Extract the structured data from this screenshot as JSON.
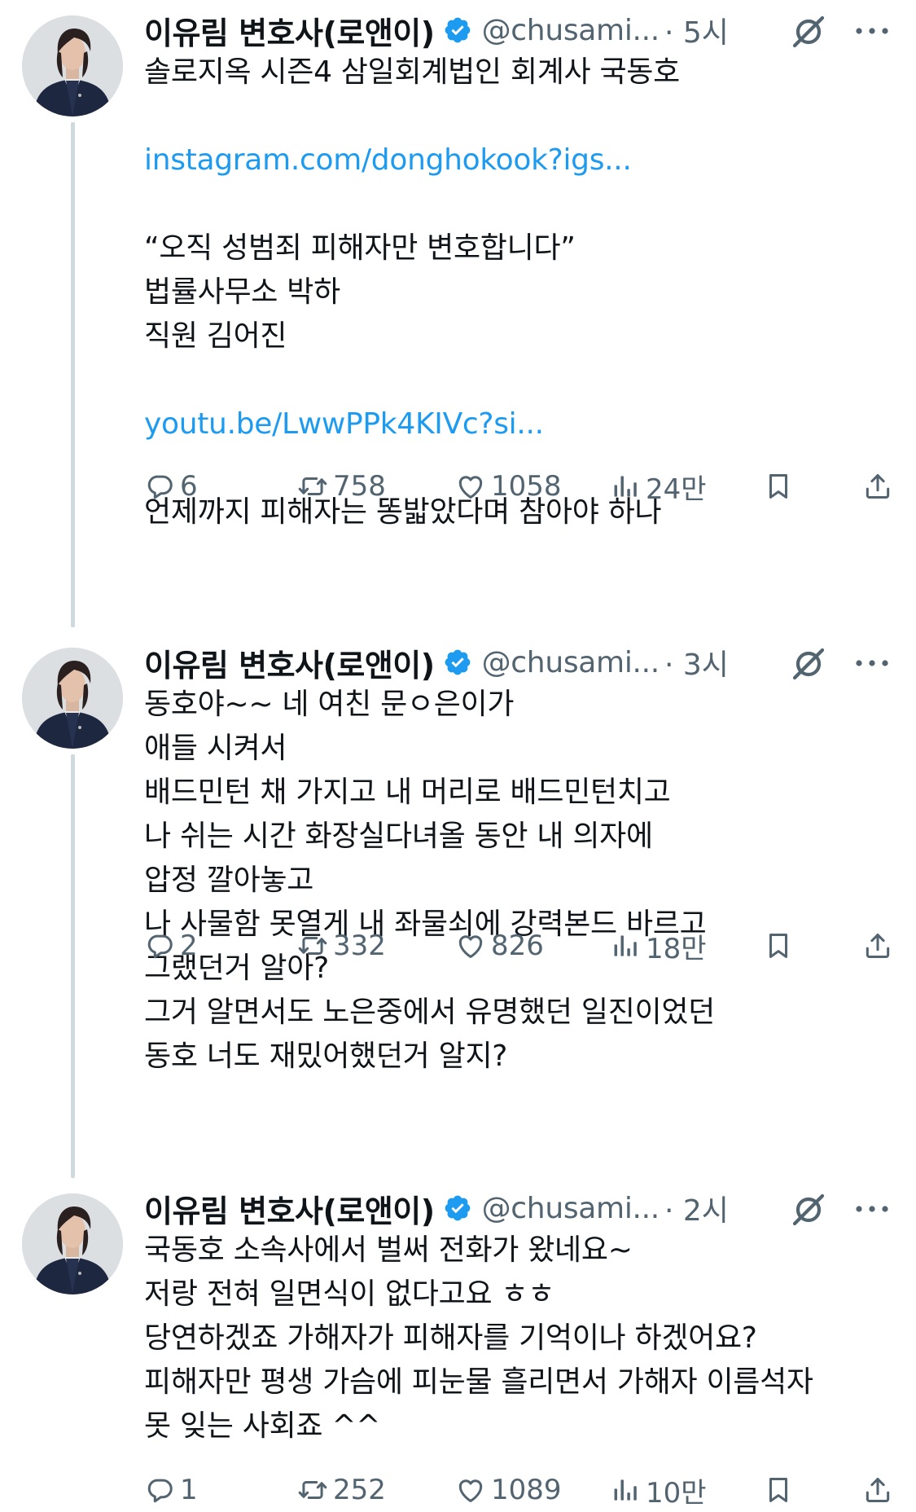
{
  "colors": {
    "link": "#1d9bf0",
    "secondary_text": "#536471",
    "verified_badge": "#1d9bf0",
    "thread_line": "#cfd9de"
  },
  "tweets": [
    {
      "author": {
        "name": "이유림 변호사(로앤이)",
        "handle": "@chusami...",
        "verified_icon": "verified-badge-icon"
      },
      "time": "· 5시",
      "lines": [
        {
          "text": "솔로지옥 시즌4 삼일회계법인 회계사 국동호",
          "link": false
        },
        {
          "text": "",
          "link": false
        },
        {
          "text": "instagram.com/donghokook?igs...",
          "link": true
        },
        {
          "text": "",
          "link": false
        },
        {
          "text": "“오직 성범죄 피해자만 변호합니다”",
          "link": false
        },
        {
          "text": "법률사무소 박하",
          "link": false
        },
        {
          "text": "직원 김어진",
          "link": false
        },
        {
          "text": "",
          "link": false
        },
        {
          "text": "youtu.be/LwwPPk4KIVc?si...",
          "link": true
        },
        {
          "text": "",
          "link": false
        },
        {
          "text": "언제까지 피해자는 똥밟았다며 참아야 하나",
          "link": false
        }
      ],
      "stats": {
        "replies": "6",
        "retweets": "758",
        "likes": "1058",
        "views": "24만"
      }
    },
    {
      "author": {
        "name": "이유림 변호사(로앤이)",
        "handle": "@chusami...",
        "verified_icon": "verified-badge-icon"
      },
      "time": "· 3시",
      "lines": [
        {
          "text": "동호야~~ 네 여친 문ㅇ은이가",
          "link": false
        },
        {
          "text": "애들 시켜서",
          "link": false
        },
        {
          "text": "배드민턴 채 가지고 내 머리로 배드민턴치고",
          "link": false
        },
        {
          "text": "나 쉬는 시간 화장실다녀올 동안 내 의자에",
          "link": false
        },
        {
          "text": "압정 깔아놓고",
          "link": false
        },
        {
          "text": "나 사물함 못열게 내 좌물쇠에 강력본드 바르고",
          "link": false
        },
        {
          "text": "그랬던거 알아?",
          "link": false
        },
        {
          "text": "그거 알면서도 노은중에서 유명했던 일진이었던",
          "link": false
        },
        {
          "text": "동호 너도 재밌어했던거 알지?",
          "link": false
        }
      ],
      "stats": {
        "replies": "2",
        "retweets": "332",
        "likes": "826",
        "views": "18만"
      }
    },
    {
      "author": {
        "name": "이유림 변호사(로앤이)",
        "handle": "@chusami...",
        "verified_icon": "verified-badge-icon"
      },
      "time": "· 2시",
      "lines": [
        {
          "text": "국동호 소속사에서 벌써 전화가 왔네요~",
          "link": false
        },
        {
          "text": "저랑 전혀 일면식이 없다고요 ㅎㅎ",
          "link": false
        },
        {
          "text": "당연하겠죠 가해자가 피해자를 기억이나 하겠어요?",
          "link": false
        },
        {
          "text": "피해자만 평생 가슴에 피눈물 흘리면서 가해자 이름석자",
          "link": false
        },
        {
          "text": "못 잊는 사회죠 ^^",
          "link": false
        }
      ],
      "stats": {
        "replies": "1",
        "retweets": "252",
        "likes": "1089",
        "views": "10만"
      }
    }
  ]
}
